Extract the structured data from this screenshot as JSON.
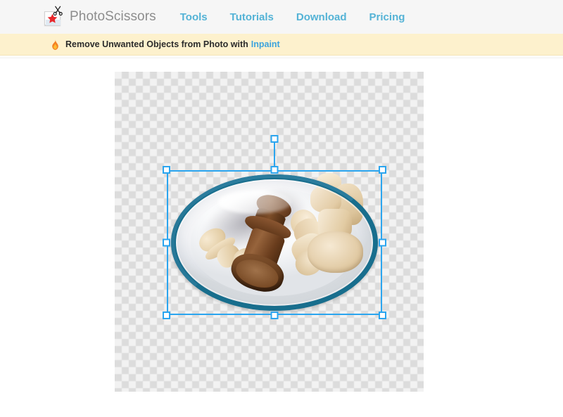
{
  "header": {
    "brand_name": "PhotoScissors",
    "logo_icon": "photo-scissors-logo",
    "nav": [
      {
        "label": "Tools",
        "icon": ""
      },
      {
        "label": "Tutorials",
        "icon": ""
      },
      {
        "label": "Download",
        "icon": ""
      },
      {
        "label": "Pricing",
        "icon": ""
      }
    ],
    "background_color": "#f6f6f6",
    "nav_link_color": "#54b3d6",
    "brand_name_color": "#8d8d8d"
  },
  "promo": {
    "icon": "flame-icon",
    "text": "Remove Unwanted Objects from Photo with",
    "link_label": "Inpaint",
    "background_color": "#fdf1cd",
    "link_color": "#3ba3dd"
  },
  "workspace": {
    "canvas": {
      "background": "transparent-checkerboard",
      "checker_size_px": 10,
      "checker_light": "#f2f2f2",
      "checker_dark": "#dcdcdc"
    },
    "selection": {
      "accent_color": "#2ba5ef",
      "handle_fill": "#ffffff",
      "handles": [
        "top-left",
        "top-center",
        "top-right",
        "middle-left",
        "middle-right",
        "bottom-left",
        "bottom-center",
        "bottom-right",
        "rotate"
      ]
    },
    "photo": {
      "subject": "chess-pieces-on-plate",
      "plate_rim_color": "#186e8d",
      "plate_color": "#fbfbfc",
      "pieces": [
        {
          "name": "light-pawn-left",
          "color": "#e3cda5",
          "pose": "lying"
        },
        {
          "name": "dark-king-center",
          "color": "#6b3f21",
          "pose": "lying"
        },
        {
          "name": "light-pawn-mid",
          "color": "#e6d1ab",
          "pose": "lying"
        },
        {
          "name": "light-knight",
          "color": "#e7d2ad",
          "pose": "standing"
        }
      ]
    }
  }
}
